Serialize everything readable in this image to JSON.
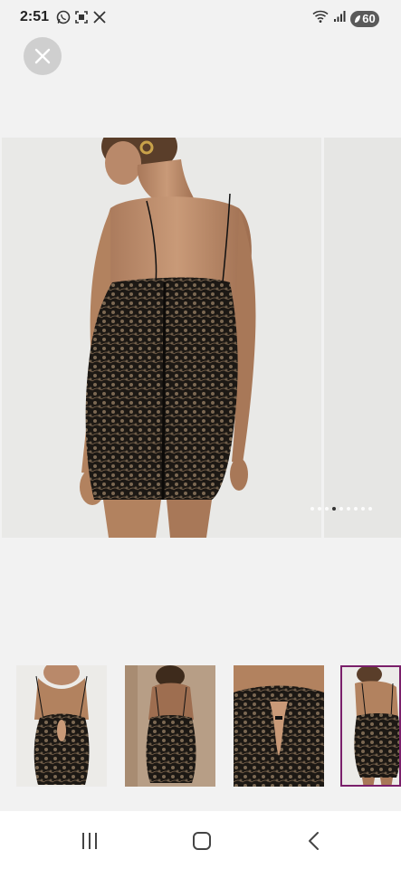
{
  "status_bar": {
    "time": "2:51",
    "left_icons": [
      "whatsapp-icon",
      "screenshot-icon",
      "x-logo-icon"
    ],
    "right_icons": [
      "wifi-icon",
      "signal-icon"
    ],
    "battery": "60"
  },
  "viewer": {
    "close_icon": "close-icon",
    "carousel": {
      "dot_count": 9,
      "active_dot_index": 3
    },
    "thumbnails": [
      {
        "view": "front"
      },
      {
        "view": "back"
      },
      {
        "view": "front-detail"
      },
      {
        "view": "back-side",
        "selected": true
      }
    ]
  },
  "nav_bar": {
    "icons": [
      "recent-apps-icon",
      "home-icon",
      "back-icon"
    ]
  },
  "colors": {
    "background": "#f2f2f2",
    "close_button": "#cfcfcf",
    "selected_thumb_border": "#7a1f6a",
    "battery_pill": "#5a5a5a",
    "nav_bar": "#ffffff"
  }
}
